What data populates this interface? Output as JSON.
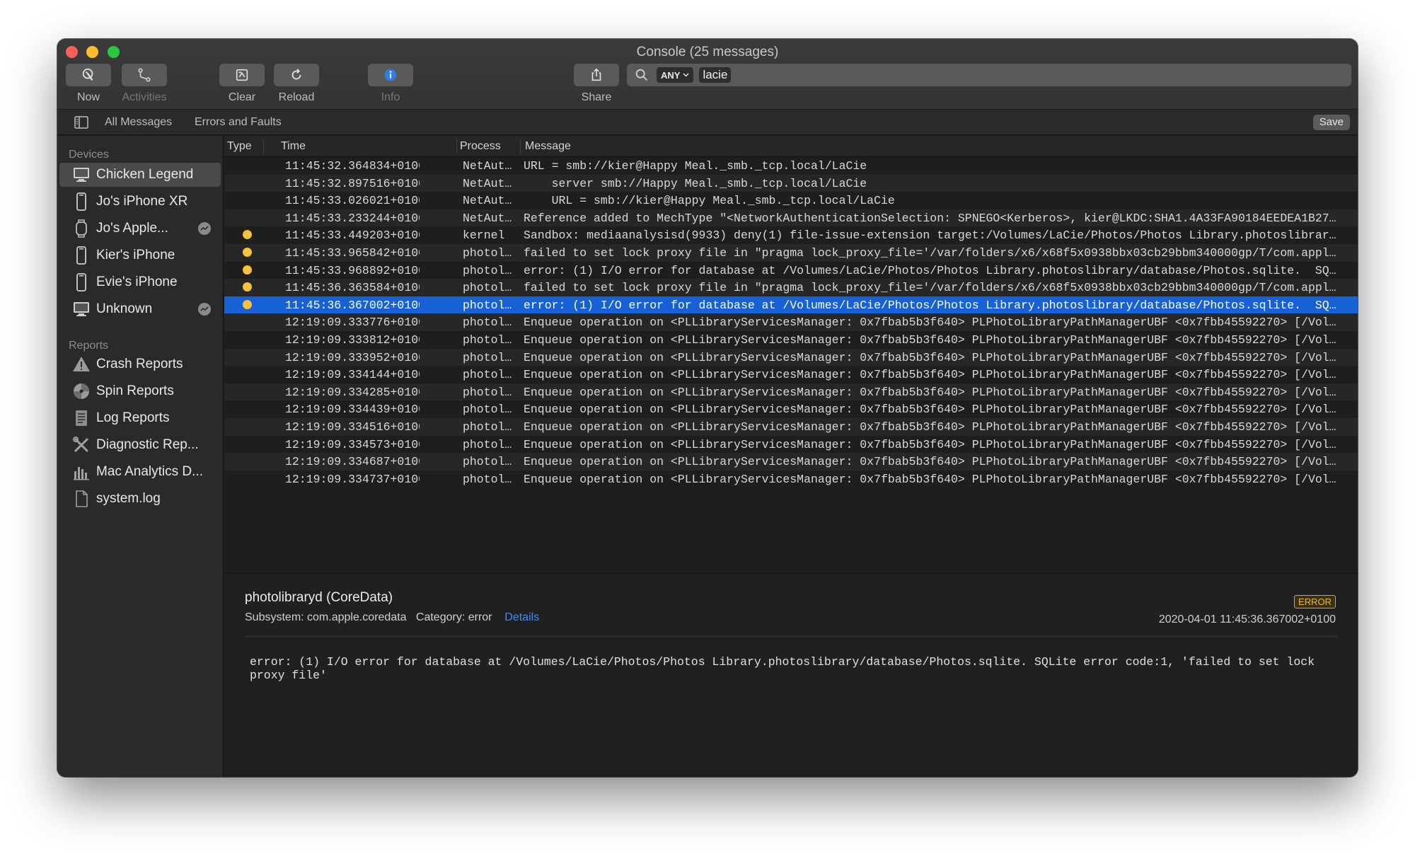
{
  "window": {
    "title": "Console (25 messages)"
  },
  "toolbar": {
    "now": "Now",
    "activities": "Activities",
    "clear": "Clear",
    "reload": "Reload",
    "info": "Info",
    "share": "Share"
  },
  "search": {
    "token": "ANY",
    "value": "lacie"
  },
  "filters": {
    "all": "All Messages",
    "errors": "Errors and Faults",
    "save": "Save"
  },
  "sidebar": {
    "devices_header": "Devices",
    "devices": [
      {
        "label": "Chicken Legend",
        "icon": "desktop-icon"
      },
      {
        "label": "Jo's iPhone XR",
        "icon": "phone-icon"
      },
      {
        "label": "Jo's Apple...",
        "icon": "watch-icon"
      },
      {
        "label": "Kier's iPhone",
        "icon": "phone-icon"
      },
      {
        "label": "Evie's iPhone",
        "icon": "phone-icon"
      },
      {
        "label": "Unknown",
        "icon": "desktop-icon"
      }
    ],
    "reports_header": "Reports",
    "reports": [
      {
        "label": "Crash Reports",
        "icon": "warning-icon"
      },
      {
        "label": "Spin Reports",
        "icon": "spinner-icon"
      },
      {
        "label": "Log Reports",
        "icon": "document-icon"
      },
      {
        "label": "Diagnostic Rep...",
        "icon": "tools-icon"
      },
      {
        "label": "Mac Analytics D...",
        "icon": "bar-chart-icon"
      },
      {
        "label": "system.log",
        "icon": "file-icon"
      }
    ]
  },
  "table": {
    "headers": {
      "type": "Type",
      "time": "Time",
      "process": "Process",
      "message": "Message"
    },
    "rows": [
      {
        "type": "",
        "time": "11:45:32.364834+0100",
        "process": "NetAut…",
        "message": "URL = smb://kier@Happy Meal._smb._tcp.local/LaCie"
      },
      {
        "type": "",
        "time": "11:45:32.897516+0100",
        "process": "NetAut…",
        "message": "    server smb://Happy Meal._smb._tcp.local/LaCie"
      },
      {
        "type": "",
        "time": "11:45:33.026021+0100",
        "process": "NetAut…",
        "message": "    URL = smb://kier@Happy Meal._smb._tcp.local/LaCie"
      },
      {
        "type": "",
        "time": "11:45:33.233244+0100",
        "process": "NetAut…",
        "message": "Reference added to MechType \"<NetworkAuthenticationSelection: SPNEGO<Kerberos>, kier@LKDC:SHA1.4A33FA90184EEDEA1B27…"
      },
      {
        "type": "error",
        "time": "11:45:33.449203+0100",
        "process": "kernel",
        "message": "Sandbox: mediaanalysisd(9933) deny(1) file-issue-extension target:/Volumes/LaCie/Photos/Photos Library.photoslibrar…"
      },
      {
        "type": "error",
        "time": "11:45:33.965842+0100",
        "process": "photol…",
        "message": "failed to set lock proxy file in \"pragma lock_proxy_file='/var/folders/x6/x68f5x0938bbx03cb29bbm340000gp/T/com.appl…"
      },
      {
        "type": "error",
        "time": "11:45:33.968892+0100",
        "process": "photol…",
        "message": "error: (1) I/O error for database at /Volumes/LaCie/Photos/Photos Library.photoslibrary/database/Photos.sqlite.  SQ…"
      },
      {
        "type": "error",
        "time": "11:45:36.363584+0100",
        "process": "photol…",
        "message": "failed to set lock proxy file in \"pragma lock_proxy_file='/var/folders/x6/x68f5x0938bbx03cb29bbm340000gp/T/com.appl…"
      },
      {
        "type": "error",
        "time": "11:45:36.367002+0100",
        "process": "photol…",
        "message": "error: (1) I/O error for database at /Volumes/LaCie/Photos/Photos Library.photoslibrary/database/Photos.sqlite.  SQ…",
        "selected": true
      },
      {
        "type": "",
        "time": "12:19:09.333776+0100",
        "process": "photol…",
        "message": "Enqueue operation on <PLLibraryServicesManager: 0x7fbab5b3f640> PLPhotoLibraryPathManagerUBF <0x7fbb45592270> [/Vol…"
      },
      {
        "type": "",
        "time": "12:19:09.333812+0100",
        "process": "photol…",
        "message": "Enqueue operation on <PLLibraryServicesManager: 0x7fbab5b3f640> PLPhotoLibraryPathManagerUBF <0x7fbb45592270> [/Vol…"
      },
      {
        "type": "",
        "time": "12:19:09.333952+0100",
        "process": "photol…",
        "message": "Enqueue operation on <PLLibraryServicesManager: 0x7fbab5b3f640> PLPhotoLibraryPathManagerUBF <0x7fbb45592270> [/Vol…"
      },
      {
        "type": "",
        "time": "12:19:09.334144+0100",
        "process": "photol…",
        "message": "Enqueue operation on <PLLibraryServicesManager: 0x7fbab5b3f640> PLPhotoLibraryPathManagerUBF <0x7fbb45592270> [/Vol…"
      },
      {
        "type": "",
        "time": "12:19:09.334285+0100",
        "process": "photol…",
        "message": "Enqueue operation on <PLLibraryServicesManager: 0x7fbab5b3f640> PLPhotoLibraryPathManagerUBF <0x7fbb45592270> [/Vol…"
      },
      {
        "type": "",
        "time": "12:19:09.334439+0100",
        "process": "photol…",
        "message": "Enqueue operation on <PLLibraryServicesManager: 0x7fbab5b3f640> PLPhotoLibraryPathManagerUBF <0x7fbb45592270> [/Vol…"
      },
      {
        "type": "",
        "time": "12:19:09.334516+0100",
        "process": "photol…",
        "message": "Enqueue operation on <PLLibraryServicesManager: 0x7fbab5b3f640> PLPhotoLibraryPathManagerUBF <0x7fbb45592270> [/Vol…"
      },
      {
        "type": "",
        "time": "12:19:09.334573+0100",
        "process": "photol…",
        "message": "Enqueue operation on <PLLibraryServicesManager: 0x7fbab5b3f640> PLPhotoLibraryPathManagerUBF <0x7fbb45592270> [/Vol…"
      },
      {
        "type": "",
        "time": "12:19:09.334687+0100",
        "process": "photol…",
        "message": "Enqueue operation on <PLLibraryServicesManager: 0x7fbab5b3f640> PLPhotoLibraryPathManagerUBF <0x7fbb45592270> [/Vol…"
      },
      {
        "type": "",
        "time": "12:19:09.334737+0100",
        "process": "photol…",
        "message": "Enqueue operation on <PLLibraryServicesManager: 0x7fbab5b3f640> PLPhotoLibraryPathManagerUBF <0x7fbb45592270> [/Vol…"
      }
    ]
  },
  "detail": {
    "title": "photolibraryd (CoreData)",
    "subsystem": "Subsystem: com.apple.coredata",
    "category": "Category: error",
    "details_link": "Details",
    "badge": "ERROR",
    "date": "2020-04-01 11:45:36.367002+0100",
    "message": "error: (1) I/O error for database at /Volumes/LaCie/Photos/Photos Library.photoslibrary/database/Photos.sqlite.  SQLite error code:1, 'failed to set lock proxy file'"
  },
  "colors": {
    "accent": "#1760d6",
    "error_dot": "#f5c33b",
    "link": "#3b8ff0",
    "badge": "#e8b739"
  }
}
